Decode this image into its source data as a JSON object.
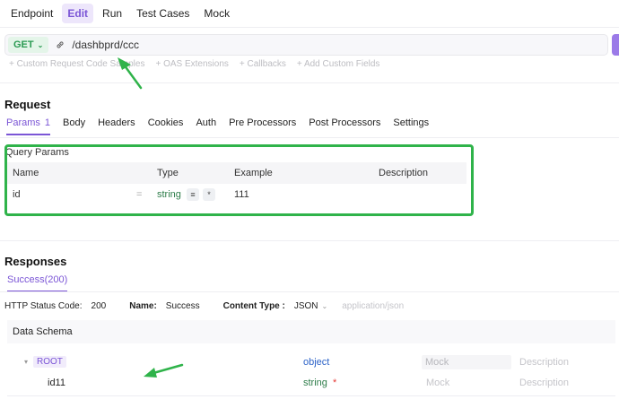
{
  "top_tabs": [
    "Endpoint",
    "Edit",
    "Run",
    "Test Cases",
    "Mock"
  ],
  "active_top_tab": "Edit",
  "url_bar": {
    "method": "GET",
    "path": "/dashbprd/ccc"
  },
  "extensions": [
    "+ Custom Request Code Samples",
    "+ OAS Extensions",
    "+ Callbacks",
    "+ Add Custom Fields"
  ],
  "request": {
    "title": "Request",
    "tabs": [
      {
        "label": "Params",
        "count": "1"
      },
      {
        "label": "Body"
      },
      {
        "label": "Headers"
      },
      {
        "label": "Cookies"
      },
      {
        "label": "Auth"
      },
      {
        "label": "Pre Processors"
      },
      {
        "label": "Post Processors"
      },
      {
        "label": "Settings"
      }
    ],
    "query_params": {
      "label": "Query Params",
      "columns": [
        "Name",
        "Type",
        "Example",
        "Description"
      ],
      "rows": [
        {
          "name": "id",
          "eq": "=",
          "type": "string",
          "icon1": "≡",
          "icon2": "*",
          "example": "111",
          "description": ""
        }
      ]
    }
  },
  "responses": {
    "title": "Responses",
    "tab": "Success(200)",
    "http_status_label": "HTTP Status Code:",
    "http_status": "200",
    "name_label": "Name:",
    "name": "Success",
    "content_type_label": "Content Type :",
    "content_type": "JSON",
    "content_type_placeholder": "application/json",
    "schema_label": "Data Schema",
    "schema_rows": [
      {
        "name": "ROOT",
        "type": "object",
        "mock": "Mock",
        "description": "Description"
      },
      {
        "name": "id11",
        "type": "string",
        "required": "*",
        "mock": "Mock",
        "description": "Description"
      }
    ]
  },
  "colors": {
    "accent": "#7b55d6",
    "annotation": "#2fb34a",
    "get": "#2a9a52"
  }
}
